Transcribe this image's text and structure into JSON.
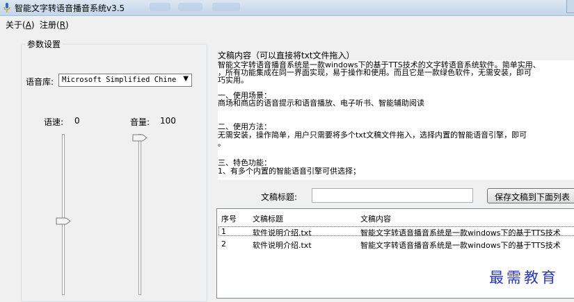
{
  "window": {
    "title": "智能文字转语音播音系统v3.5"
  },
  "menu": [
    {
      "label": "关于",
      "key": "A"
    },
    {
      "label": "注册",
      "key": "R"
    }
  ],
  "params": {
    "group_title": "参数设置",
    "voice_label": "语音库:",
    "voice_value": "Microsoft Simplified Chine",
    "speed_label": "语速:",
    "speed_value": "0",
    "volume_label": "音量:",
    "volume_value": "100"
  },
  "content": {
    "group_label": "文稿内容（可以直接将txt文件拖入）",
    "lines": [
      "智能文字转语音播音系统是一款windows下的基于TTS技术的文字转语音系统软件。简单实用、",
      "，所有功能集成在同一界面实现，易于操作和使用。而且它是一款绿色软件，无需安装，即可",
      "巧实用。",
      "",
      "一、使用场景：",
      "商场和商店的语音提示和语音播放、电子听书、智能辅助阅读",
      "",
      "二、使用方法：",
      "无需安装，操作简单，用户只需要将多个txt文稿文件拖入，选择内置的智能语音引擎，即可",
      "。",
      "",
      "三、特色功能：",
      "1、有多个内置的智能语音引擎可供选择；"
    ]
  },
  "doc_title": {
    "label": "文稿标题:",
    "value": "",
    "save_button": "保存文稿到下面列表"
  },
  "table": {
    "columns": [
      "序号",
      "文稿标题",
      "文稿内容"
    ],
    "rows": [
      [
        "1",
        "软件说明介绍.txt",
        "智能文字转语音播音系统是一款windows下的基于TTS技术"
      ],
      [
        "2",
        "软件说明介绍.txt",
        "智能文字转语音播音系统是一款windows下的基于TTS技术"
      ]
    ]
  },
  "watermark": "最需教育"
}
